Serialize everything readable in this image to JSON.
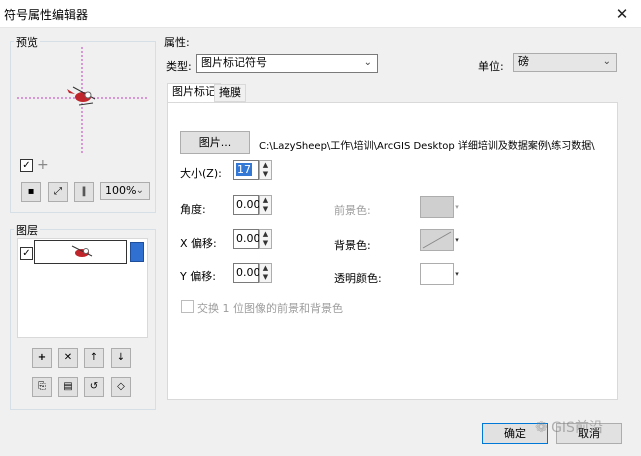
{
  "window": {
    "title": "符号属性编辑器",
    "close_glyph": "✕"
  },
  "preview": {
    "group_label": "预览",
    "zoom_value": "100%",
    "checkbox_checked": true
  },
  "layers": {
    "group_label": "图层",
    "items": [
      {
        "checked": true
      }
    ]
  },
  "properties": {
    "group_label": "属性:",
    "type_label": "类型:",
    "type_value": "图片标记符号",
    "unit_label": "单位:",
    "unit_value": "磅",
    "tabs": [
      {
        "label": "图片标记",
        "active": true
      },
      {
        "label": "掩膜",
        "active": false
      }
    ],
    "picture_button": "图片...",
    "picture_path": "C:\\LazySheep\\工作\\培训\\ArcGIS Desktop 详细培训及数据案例\\练习数据\\",
    "size_label": "大小(Z):",
    "size_value": "17",
    "angle_label": "角度:",
    "angle_value": "0.00",
    "xoffset_label": "X 偏移:",
    "xoffset_value": "0.00",
    "yoffset_label": "Y 偏移:",
    "yoffset_value": "0.00",
    "foreground_label": "前景色:",
    "background_label": "背景色:",
    "transparent_label": "透明颜色:",
    "swap_label": "交换 1 位图像的前景和背景色",
    "colors": {
      "foreground": "#cfcfcf",
      "background": "#d4d4d4",
      "transparent": "#ffffff"
    }
  },
  "footer": {
    "ok_label": "确定",
    "cancel_label": "取消",
    "watermark": "GIS前沿"
  },
  "icons": {
    "close": "close-icon",
    "fit": "fit-icon",
    "expand": "expand-icon",
    "pause": "pause-icon",
    "add": "add-icon",
    "delete": "delete-icon",
    "up": "up-icon",
    "down": "down-icon"
  }
}
